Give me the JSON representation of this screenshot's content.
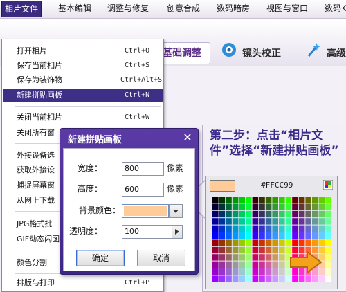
{
  "menubar": {
    "items": [
      {
        "label": "相片文件",
        "active": true
      },
      {
        "label": "基本编辑"
      },
      {
        "label": "调整与修复"
      },
      {
        "label": "创意合成"
      },
      {
        "label": "数码暗房"
      },
      {
        "label": "视图与窗口"
      },
      {
        "label": "数码ぐ"
      }
    ]
  },
  "toolbar": {
    "tab_label": "基础调整",
    "lens_label": "镜头校正",
    "high_label": "高级"
  },
  "dropdown": {
    "items": [
      {
        "label": "打开相片",
        "shortcut": "Ctrl+O"
      },
      {
        "label": "保存当前相片",
        "shortcut": "Ctrl+S"
      },
      {
        "label": "保存为装饰物",
        "shortcut": "Ctrl+Alt+S"
      },
      {
        "label": "新建拼贴画板",
        "shortcut": "Ctrl+N",
        "highlighted": true
      },
      {
        "label": "关闭当前相片",
        "shortcut": "Ctrl+W"
      },
      {
        "label": "关闭所有窗",
        "shortcut": ""
      },
      {
        "label": "外接设备选",
        "shortcut": ""
      },
      {
        "label": "获取外接设",
        "shortcut": ""
      },
      {
        "label": "捕捉屏幕窗",
        "shortcut": ""
      },
      {
        "label": "从网上下载",
        "shortcut": ""
      },
      {
        "label": "JPG格式批",
        "shortcut": ""
      },
      {
        "label": "GIF动态闪图",
        "shortcut": ""
      },
      {
        "label": "颜色分割",
        "shortcut": ""
      },
      {
        "label": "排版与打印",
        "shortcut": "Ctrl+P"
      }
    ]
  },
  "dialog": {
    "title": "新建拼贴画板",
    "width_label": "宽度：",
    "width_value": "800",
    "width_unit": "像素",
    "height_label": "高度：",
    "height_value": "600",
    "height_unit": "像素",
    "bg_label": "背景颜色：",
    "bg_color": "#FFCC99",
    "opacity_label": "透明度：",
    "opacity_value": "100",
    "ok_label": "确定",
    "cancel_label": "取消"
  },
  "callout": {
    "text": "第二步：点击“相片文件”选择“新建拼贴画板”"
  },
  "picker": {
    "hex": "#FFCC99",
    "selected_color": "#FFCC99"
  },
  "colors": {
    "menu_active": "#3b2a7e",
    "dialog_title": "#4a2f96",
    "accent_text": "#3c2a8a",
    "toolbar_tab_text": "#5a2d86"
  }
}
